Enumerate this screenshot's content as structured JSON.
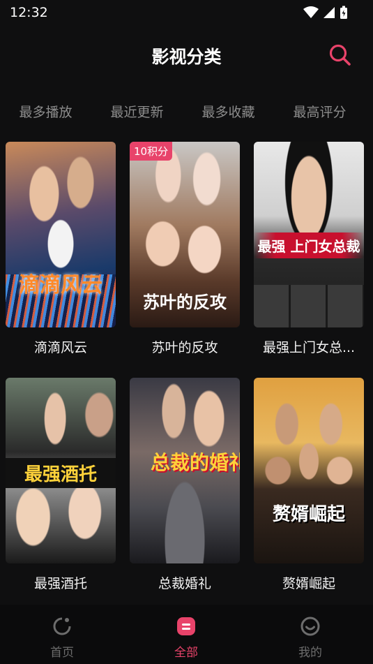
{
  "status": {
    "time": "12:32"
  },
  "header": {
    "title": "影视分类"
  },
  "tabs": [
    "最多播放",
    "最近更新",
    "最多收藏",
    "最高评分"
  ],
  "items": [
    {
      "caption": "滴滴风云",
      "poster_text": "滴滴风云",
      "badge": ""
    },
    {
      "caption": "苏叶的反攻",
      "poster_text": "苏叶的反攻",
      "badge": "10积分"
    },
    {
      "caption": "最强上门女总...",
      "poster_text": "最强 上门女总裁",
      "badge": ""
    },
    {
      "caption": "最强酒托",
      "poster_text": "最强酒托",
      "badge": ""
    },
    {
      "caption": "总裁婚礼",
      "poster_text": "总裁的婚礼",
      "badge": ""
    },
    {
      "caption": "赘婿崛起",
      "poster_text": "赘婿崛起",
      "badge": ""
    }
  ],
  "nav": [
    {
      "label": "首页",
      "icon": "home-icon"
    },
    {
      "label": "全部",
      "icon": "category-icon"
    },
    {
      "label": "我的",
      "icon": "profile-icon"
    }
  ],
  "colors": {
    "accent": "#e8436a",
    "background": "#0f0f10",
    "inactive": "#6d6d6d"
  }
}
